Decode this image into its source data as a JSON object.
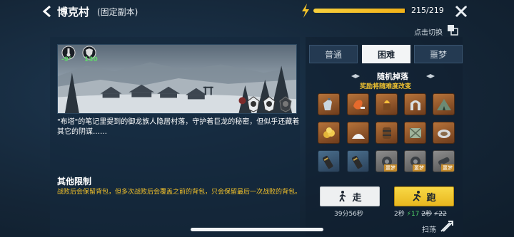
{
  "header": {
    "title": "博克村",
    "subtitle": "(固定副本)",
    "energy_text": "215/219",
    "energy_fraction": 0.982
  },
  "scene": {
    "stat_temp": "-9°",
    "stat_shield": "130",
    "description": "\"布塔\"的笔记里提到的御龙族人隐居村落，守护着巨龙的秘密，但似乎还藏着其它的阴谋……"
  },
  "limits": {
    "title": "其他限制",
    "text": "战败后会保留背包，但多次战败后会覆盖之前的背包，只会保留最后一次战败的背包。"
  },
  "switch_label": "点击切换",
  "tabs": [
    "普通",
    "困难",
    "噩梦"
  ],
  "active_tab": "困难",
  "drops": {
    "title": "随机掉落",
    "subtitle": "奖励将随难度改变",
    "items": [
      {
        "icon": "potion-bag-icon",
        "tier": "orange"
      },
      {
        "icon": "meat-icon",
        "tier": "orange"
      },
      {
        "icon": "fire-pot-icon",
        "tier": "orange"
      },
      {
        "icon": "horseshoe-magnet-icon",
        "tier": "orange"
      },
      {
        "icon": "tent-icon",
        "tier": "orange"
      },
      {
        "icon": "gold-coins-icon",
        "tier": "orange"
      },
      {
        "icon": "salt-pile-icon",
        "tier": "orange"
      },
      {
        "icon": "barrel-icon",
        "tier": "orange"
      },
      {
        "icon": "crate-icon",
        "tier": "orange"
      },
      {
        "icon": "plate-icon",
        "tier": "orange"
      },
      {
        "icon": "scroll-icon",
        "tier": "blue"
      },
      {
        "icon": "scroll-icon",
        "tier": "blue"
      },
      {
        "icon": "gear-icon",
        "tier": "gray",
        "tag": "噩梦"
      },
      {
        "icon": "gear-icon",
        "tier": "gray",
        "tag": "噩梦"
      },
      {
        "icon": "cannon-icon",
        "tier": "gray",
        "tag": "噩梦"
      }
    ]
  },
  "walk_button": {
    "label": "走",
    "time": "39分56秒"
  },
  "run_button": {
    "label": "跑",
    "time": "2秒",
    "energy": "17",
    "old_time": "2秒",
    "old_energy": "22"
  },
  "raid_label": "扫荡"
}
